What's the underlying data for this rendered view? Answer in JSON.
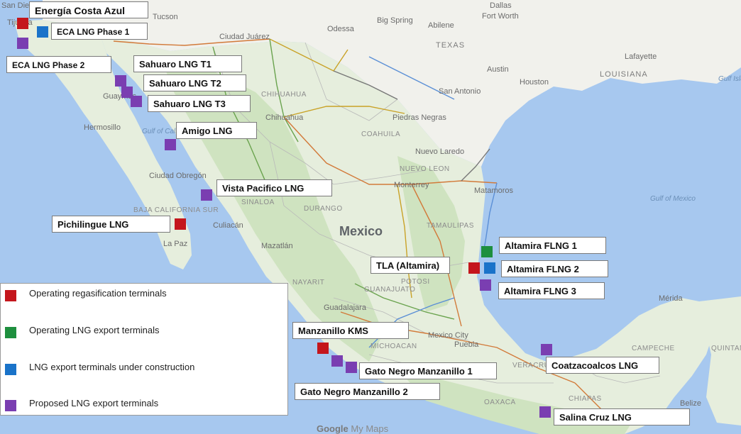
{
  "map": {
    "main_country": "Mexico",
    "country_labels_us": [
      "TEXAS",
      "LOUISIANA"
    ],
    "neighbor_labels": [
      "Belize"
    ],
    "state_labels": [
      "CHIHUAHUA",
      "COAHUILA",
      "NUEVO LEON",
      "DURANGO",
      "SINALOA",
      "BAJA CALIFORNIA SUR",
      "TAMAULIPAS",
      "NAYARIT",
      "GUANAJUATO",
      "MICHOACAN",
      "CHIAPAS",
      "CAMPECHE",
      "QUINTANA ROO",
      "OAXACA",
      "POTOSI",
      "VERACRUZ"
    ],
    "sea_labels": [
      "Gulf of California",
      "Gulf of Mexico",
      "Gulf Islands"
    ],
    "city_labels": [
      "San Diego",
      "Tijuana",
      "Tucson",
      "Ciudad Juárez",
      "Dallas",
      "Fort Worth",
      "Austin",
      "Houston",
      "San Antonio",
      "Chihuahua",
      "Monterrey",
      "Matamoros",
      "Nuevo Laredo",
      "Piedras Negras",
      "Guadalajara",
      "Mexico City",
      "Mérida",
      "Hermosillo",
      "Culiacán",
      "Mazatlán",
      "La Paz",
      "Puebla",
      "Ciudad Obregón",
      "Guaymas",
      "Lafayette",
      "Big Spring",
      "Abilene",
      "Odessa"
    ],
    "attribution": {
      "brand": "Google",
      "product": "My Maps"
    }
  },
  "colors": {
    "water": "#a7c8ef",
    "land": "#e6eedd",
    "land_green": "#cfe3c0",
    "us_land": "#f1f1ec",
    "operating_regas": "#c4161c",
    "operating_export": "#1e8f3e",
    "under_construction": "#1a73c9",
    "proposed": "#7a3eb1"
  },
  "terminals": [
    {
      "name": "Energía Costa Azul",
      "status": "operating_regas"
    },
    {
      "name": "ECA LNG Phase 1",
      "status": "under_construction"
    },
    {
      "name": "ECA LNG Phase 2",
      "status": "proposed"
    },
    {
      "name": "Sahuaro LNG T1",
      "status": "proposed"
    },
    {
      "name": "Sahuaro LNG T2",
      "status": "proposed"
    },
    {
      "name": "Sahuaro LNG T3",
      "status": "proposed"
    },
    {
      "name": "Amigo LNG",
      "status": "proposed"
    },
    {
      "name": "Vista Pacifico LNG",
      "status": "proposed"
    },
    {
      "name": "Pichilingue LNG",
      "status": "operating_regas"
    },
    {
      "name": "Altamira FLNG 1",
      "status": "operating_export"
    },
    {
      "name": "Altamira FLNG 2",
      "status": "under_construction"
    },
    {
      "name": "TLA (Altamira)",
      "status": "operating_regas"
    },
    {
      "name": "Altamira FLNG 3",
      "status": "proposed"
    },
    {
      "name": "Manzanillo KMS",
      "status": "operating_regas"
    },
    {
      "name": "Gato Negro Manzanillo 1",
      "status": "proposed"
    },
    {
      "name": "Gato Negro Manzanillo 2",
      "status": "proposed"
    },
    {
      "name": "Coatzacoalcos LNG",
      "status": "proposed"
    },
    {
      "name": "Salina Cruz LNG",
      "status": "proposed"
    }
  ],
  "legend": {
    "items": [
      {
        "label": "Operating regasification terminals",
        "status": "operating_regas"
      },
      {
        "label": "Operating LNG export terminals",
        "status": "operating_export"
      },
      {
        "label": "LNG export terminals under construction",
        "status": "under_construction"
      },
      {
        "label": "Proposed LNG export terminals",
        "status": "proposed"
      }
    ]
  }
}
